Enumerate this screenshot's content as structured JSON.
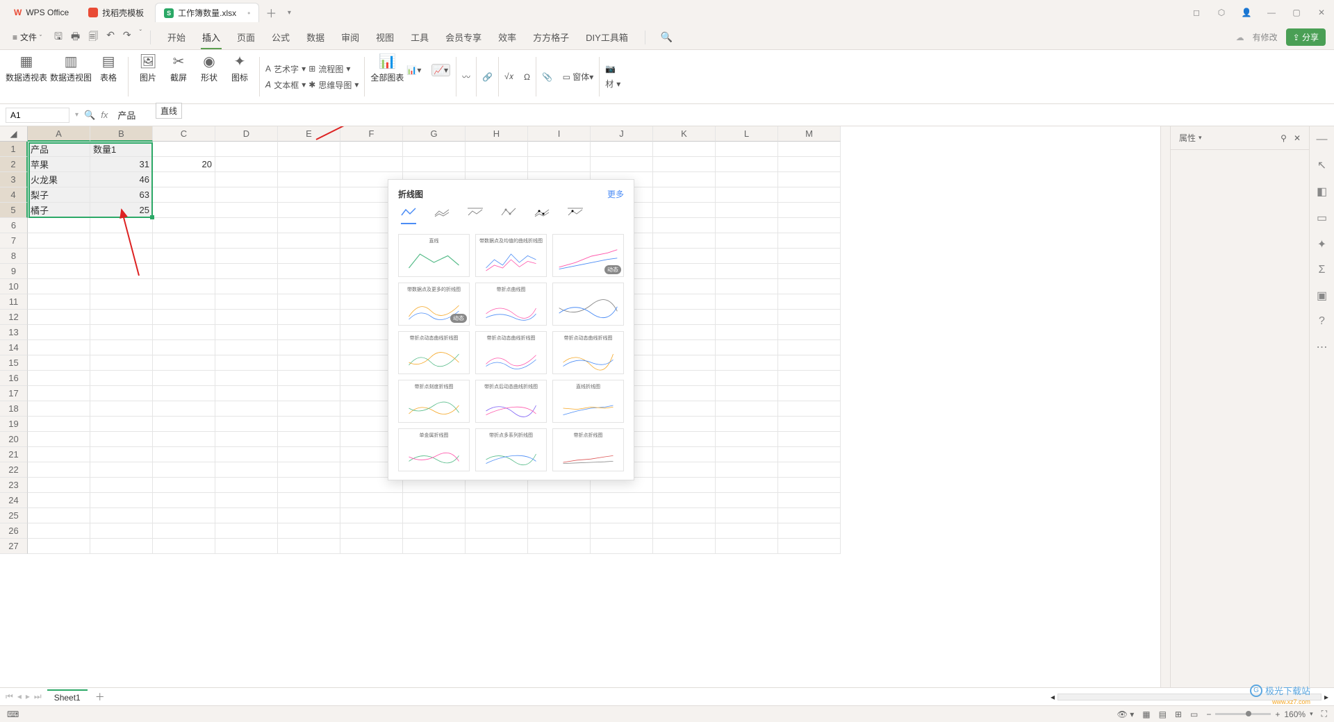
{
  "titlebar": {
    "app": "WPS Office",
    "template_tab": "找稻壳模板",
    "doc_tab": "工作簿数量.xlsx",
    "doc_badge": "S"
  },
  "menu": {
    "file": "文件",
    "tabs": [
      "开始",
      "插入",
      "页面",
      "公式",
      "数据",
      "审阅",
      "视图",
      "工具",
      "会员专享",
      "效率",
      "方方格子",
      "DIY工具箱"
    ],
    "active_index": 1,
    "cloud_text": "有修改",
    "share": "分享"
  },
  "ribbon": {
    "pivot_table": "数据透视表",
    "pivot_chart": "数据透视图",
    "table": "表格",
    "picture": "图片",
    "screenshot": "截屏",
    "shape": "形状",
    "icon": "图标",
    "wordart": "艺术字",
    "textbox": "文本框",
    "flowchart": "流程图",
    "mindmap": "思维导图",
    "all_charts": "全部图表",
    "equation": "公式",
    "symbol": "符号",
    "form": "窗体",
    "material": "材",
    "chart_tip": "直线"
  },
  "formula_bar": {
    "cell_ref": "A1",
    "value": "产品"
  },
  "columns": [
    "A",
    "B",
    "C",
    "D",
    "E",
    "F",
    "G",
    "H",
    "I",
    "J",
    "K",
    "L",
    "M"
  ],
  "row_count": 27,
  "data": {
    "A1": "产品",
    "B1": "数量1",
    "A2": "苹果",
    "B2": "31",
    "C2": "20",
    "A3": "火龙果",
    "B3": "46",
    "A4": "梨子",
    "B4": "63",
    "A5": "橘子",
    "B5": "25"
  },
  "chart_popup": {
    "title": "折线图",
    "more": "更多",
    "badge": "动态",
    "thumb_titles": [
      "直线",
      "带数据点及均值的曲线折线图",
      "",
      "带数据点及更多的折线图",
      "带折点曲线图",
      "",
      "带折点动态曲线折线图",
      "带折点动态曲线折线图",
      "带折点动态曲线折线图",
      "带折点刻度折线图",
      "带折点后动态曲线折线图",
      "直线折线图",
      "单金属折线图",
      "带折点多系列折线图",
      "带折点折线图"
    ]
  },
  "prop_panel": {
    "title": "属性"
  },
  "sheet_tabs": {
    "sheet1": "Sheet1"
  },
  "statusbar": {
    "zoom": "160%"
  },
  "watermark": {
    "brand": "极光下载站",
    "url": "www.xz7.com"
  }
}
